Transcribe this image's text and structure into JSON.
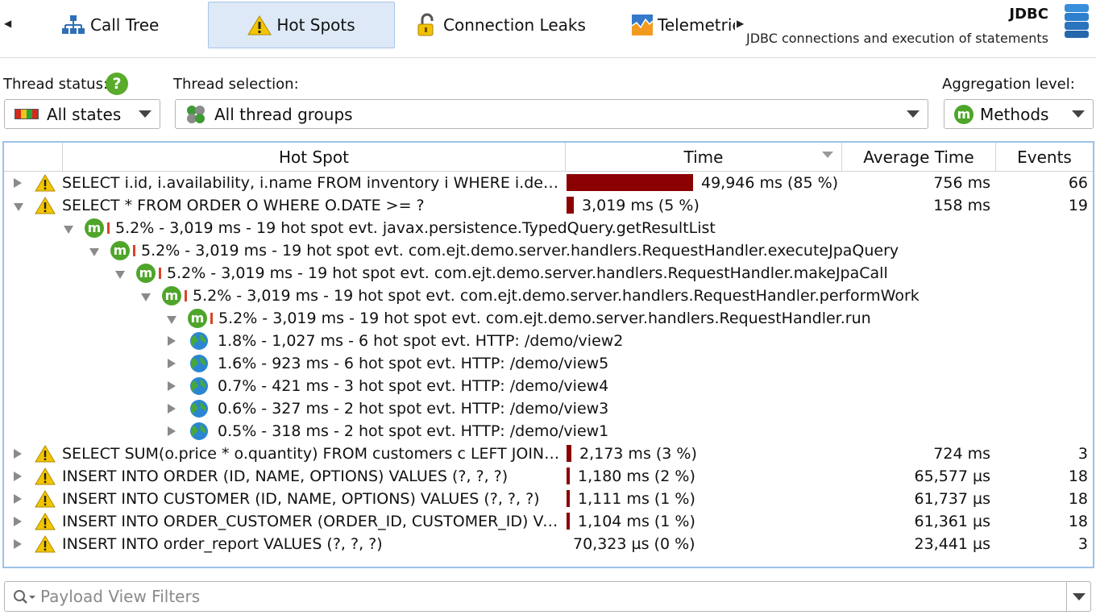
{
  "tabs": {
    "scroll_left": "◀",
    "scroll_right": "▶",
    "items": [
      {
        "label": "Call Tree",
        "icon": "call-tree-icon",
        "active": false
      },
      {
        "label": "Hot Spots",
        "icon": "warning-icon",
        "active": true
      },
      {
        "label": "Connection Leaks",
        "icon": "unlocked-padlock-icon",
        "active": false
      },
      {
        "label": "Telemetrie",
        "icon": "telemetry-icon",
        "active": false
      }
    ]
  },
  "header": {
    "title": "JDBC",
    "subtitle": "JDBC connections and execution of statements",
    "icon": "database-icon"
  },
  "filters": {
    "thread_status_label": "Thread status:",
    "thread_status_value": "All states",
    "thread_selection_label": "Thread selection:",
    "thread_selection_value": "All thread groups",
    "aggregation_label": "Aggregation level:",
    "aggregation_value": "Methods",
    "aggregation_icon_letter": "m",
    "help_glyph": "?"
  },
  "table": {
    "columns": [
      "Hot Spot",
      "Time",
      "Average Time",
      "Events"
    ],
    "sorted_column": "Time",
    "rows": [
      {
        "kind": "hotspot",
        "expanded": false,
        "text": "SELECT i.id, i.availability, i.name FROM inventory i WHERE i.delay…",
        "time": "49,946 ms (85 %)",
        "fraction": 0.85,
        "avg": "756 ms",
        "events": "66"
      },
      {
        "kind": "hotspot",
        "expanded": true,
        "text": "SELECT * FROM ORDER O WHERE O.DATE >= ?",
        "time": "3,019 ms (5 %)",
        "fraction": 0.05,
        "avg": "158 ms",
        "events": "19"
      },
      {
        "kind": "method",
        "level": 1,
        "text": "5.2% - 3,019 ms - 19 hot spot evt. javax.persistence.TypedQuery.getResultList"
      },
      {
        "kind": "method",
        "level": 2,
        "text": "5.2% - 3,019 ms - 19 hot spot evt. com.ejt.demo.server.handlers.RequestHandler.executeJpaQuery"
      },
      {
        "kind": "method",
        "level": 3,
        "text": "5.2% - 3,019 ms - 19 hot spot evt. com.ejt.demo.server.handlers.RequestHandler.makeJpaCall"
      },
      {
        "kind": "method",
        "level": 4,
        "text": "5.2% - 3,019 ms - 19 hot spot evt. com.ejt.demo.server.handlers.RequestHandler.performWork"
      },
      {
        "kind": "method",
        "level": 5,
        "text": "5.2% - 3,019 ms - 19 hot spot evt. com.ejt.demo.server.handlers.RequestHandler.run"
      },
      {
        "kind": "url",
        "level": 6,
        "text": "1.8% - 1,027 ms - 6 hot spot evt. HTTP: /demo/view2"
      },
      {
        "kind": "url",
        "level": 6,
        "text": "1.6% - 923 ms - 6 hot spot evt. HTTP: /demo/view5"
      },
      {
        "kind": "url",
        "level": 6,
        "text": "0.7% - 421 ms - 3 hot spot evt. HTTP: /demo/view4"
      },
      {
        "kind": "url",
        "level": 6,
        "text": "0.6% - 327 ms - 2 hot spot evt. HTTP: /demo/view3"
      },
      {
        "kind": "url",
        "level": 6,
        "text": "0.5% - 318 ms - 2 hot spot evt. HTTP: /demo/view1"
      },
      {
        "kind": "hotspot",
        "expanded": false,
        "text": "SELECT SUM(o.price * o.quantity) FROM customers c LEFT JOIN or…",
        "time": "2,173 ms (3 %)",
        "fraction": 0.03,
        "avg": "724 ms",
        "events": "3"
      },
      {
        "kind": "hotspot",
        "expanded": false,
        "text": "INSERT INTO ORDER (ID, NAME, OPTIONS) VALUES (?, ?, ?)",
        "time": "1,180 ms (2 %)",
        "fraction": 0.02,
        "avg": "65,577 µs",
        "events": "18"
      },
      {
        "kind": "hotspot",
        "expanded": false,
        "text": "INSERT INTO CUSTOMER (ID, NAME, OPTIONS) VALUES (?, ?, ?)",
        "time": "1,111 ms (1 %)",
        "fraction": 0.01,
        "avg": "61,737 µs",
        "events": "18"
      },
      {
        "kind": "hotspot",
        "expanded": false,
        "text": "INSERT INTO ORDER_CUSTOMER (ORDER_ID, CUSTOMER_ID) VALUES (?, ?)",
        "time": "1,104 ms (1 %)",
        "fraction": 0.01,
        "avg": "61,361 µs",
        "events": "18"
      },
      {
        "kind": "hotspot",
        "expanded": false,
        "text": "INSERT INTO order_report VALUES (?, ?, ?)",
        "time": "70,323 µs (0 %)",
        "fraction": 0.0,
        "avg": "23,441 µs",
        "events": "3"
      }
    ]
  },
  "payload_filter": {
    "placeholder": "Payload View Filters"
  },
  "colors": {
    "bar": "#8b0000",
    "accent_border": "#9cc2e6",
    "active_tab": "#dde9f6",
    "method_icon": "#4ea52a",
    "mini_bar": "#d9432a"
  }
}
